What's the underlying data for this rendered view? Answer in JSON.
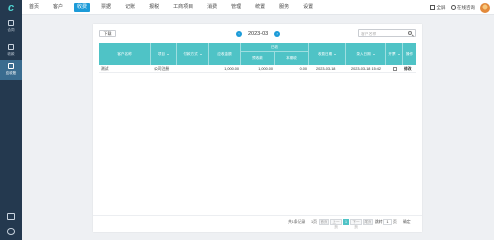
{
  "nav": [
    {
      "label": "首页",
      "active": false
    },
    {
      "label": "客户",
      "active": false
    },
    {
      "label": "收费",
      "active": true
    },
    {
      "label": "票据",
      "active": false
    },
    {
      "label": "记账",
      "active": false
    },
    {
      "label": "报税",
      "active": false
    },
    {
      "label": "工商项目",
      "active": false
    },
    {
      "label": "消费",
      "active": false
    },
    {
      "label": "管理",
      "active": false
    },
    {
      "label": "统置",
      "active": false
    },
    {
      "label": "服务",
      "active": false
    },
    {
      "label": "设置",
      "active": false
    }
  ],
  "top_right": {
    "fullscreen_label": "全屏",
    "service_label": "在线咨询"
  },
  "sidebar": {
    "items": [
      {
        "label": "合同",
        "icon": "contract-icon"
      },
      {
        "label": "收款",
        "icon": "payment-icon"
      },
      {
        "label": "应收账",
        "icon": "receivable-icon",
        "active": true
      }
    ]
  },
  "toolbar": {
    "import_label": "下载",
    "month": "2023-03",
    "prev_label": "‹",
    "next_label": "›",
    "search_placeholder": "客户名称"
  },
  "table": {
    "headers": {
      "customer": "客户名称",
      "item": "项目",
      "method": "付款方式",
      "receivable": "应收金额",
      "received_group": "已收",
      "advance": "预收款",
      "current": "本期收",
      "charge_date": "收费日期",
      "entry_date": "录入日期",
      "invoice": "开票",
      "operation": "操作"
    },
    "rows": [
      {
        "customer": "测试",
        "item": "公司注册",
        "method": "",
        "receivable": "1,000.00",
        "advance": "1,000.00",
        "current": "0.00",
        "charge_date": "2023-03-18",
        "entry_date": "2023-03-18 15:42",
        "invoice": false,
        "operation": "修改"
      }
    ]
  },
  "pager": {
    "total_label": "共1条记录",
    "prefix": "1页",
    "first": "首页",
    "prev": "上一页",
    "current": "1",
    "next": "下一页",
    "last": "尾页",
    "goto_label": "跳转",
    "goto_value": "1",
    "page_unit": "页",
    "confirm": "确定"
  }
}
